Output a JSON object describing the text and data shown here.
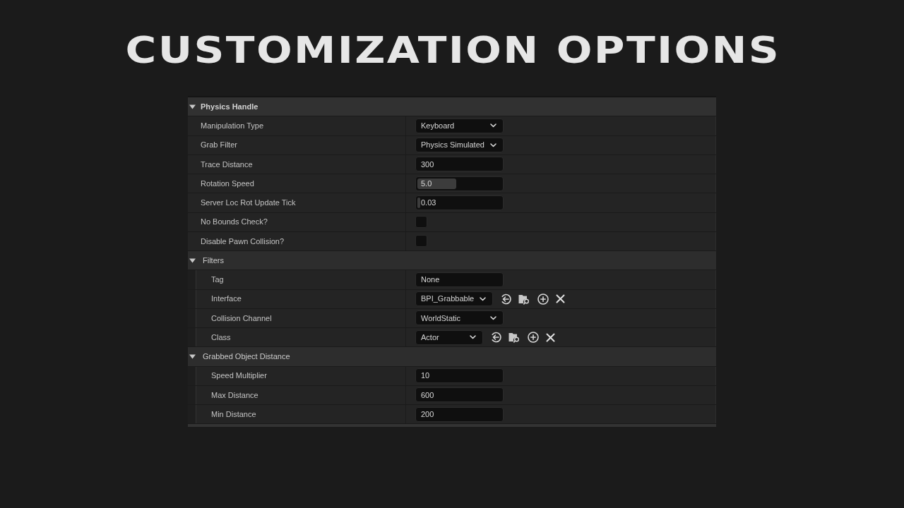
{
  "title": "CUSTOMIZATION OPTIONS",
  "sections": [
    {
      "label": "Physics Handle",
      "kind": "category",
      "expanded": true,
      "rows": [
        {
          "label": "Manipulation Type",
          "kind": "dropdown",
          "value": "Keyboard"
        },
        {
          "label": "Grab Filter",
          "kind": "dropdown",
          "value": "Physics Simulated"
        },
        {
          "label": "Trace Distance",
          "kind": "field",
          "value": "300"
        },
        {
          "label": "Rotation Speed",
          "kind": "slider",
          "value": "5.0",
          "level": 0.46
        },
        {
          "label": "Server Loc Rot Update Tick",
          "kind": "slider",
          "value": "0.03",
          "level": 0.03
        },
        {
          "label": "No Bounds Check?",
          "kind": "checkbox",
          "checked": false
        },
        {
          "label": "Disable Pawn Collision?",
          "kind": "checkbox",
          "checked": false
        }
      ]
    },
    {
      "label": "Filters",
      "kind": "subcategory",
      "expanded": true,
      "rows": [
        {
          "label": "Tag",
          "kind": "field",
          "value": "None"
        },
        {
          "label": "Interface",
          "kind": "asset",
          "value": "BPI_Grabbable"
        },
        {
          "label": "Collision Channel",
          "kind": "dropdown",
          "value": "WorldStatic"
        },
        {
          "label": "Class",
          "kind": "asset",
          "value": "Actor"
        }
      ]
    },
    {
      "label": "Grabbed Object Distance",
      "kind": "subcategory",
      "expanded": true,
      "rows": [
        {
          "label": "Speed Multiplier",
          "kind": "field",
          "value": "10"
        },
        {
          "label": "Max Distance",
          "kind": "field",
          "value": "600"
        },
        {
          "label": "Min Distance",
          "kind": "field",
          "value": "200"
        }
      ]
    }
  ]
}
